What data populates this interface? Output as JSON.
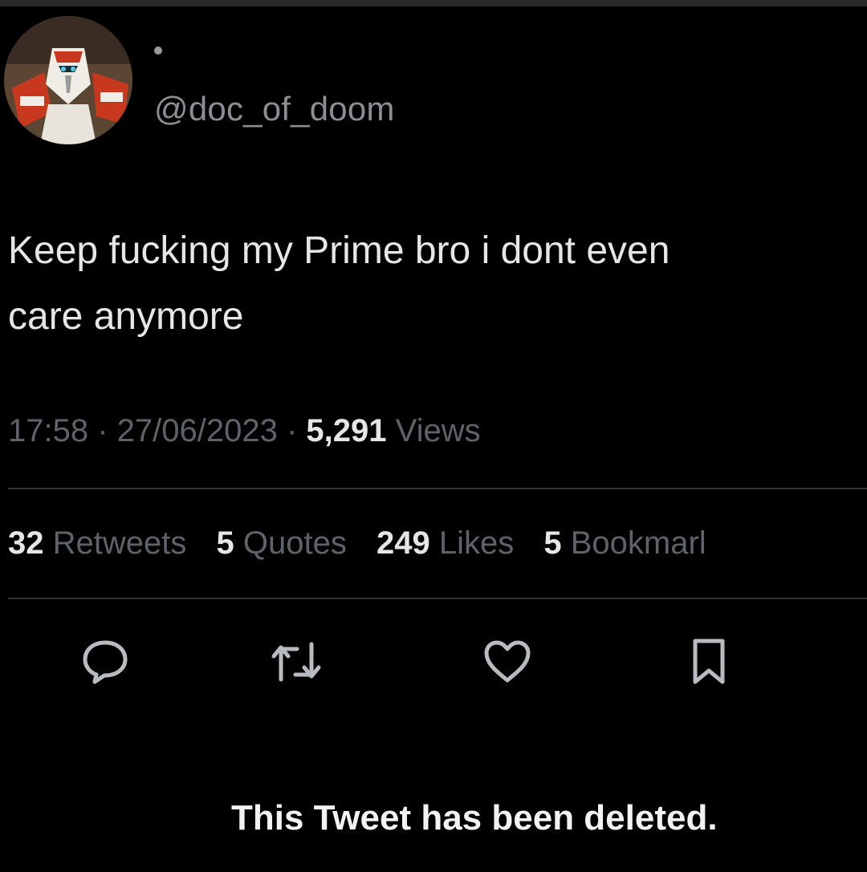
{
  "tweet": {
    "handle": "@doc_of_doom",
    "text_line1": "Keep fucking my Prime bro i dont even",
    "text_line2": "care anymore",
    "time": "17:58",
    "date": "27/06/2023",
    "views_count": "5,291",
    "views_label": "Views"
  },
  "stats": [
    {
      "count": "32",
      "label": "Retweets"
    },
    {
      "count": "5",
      "label": "Quotes"
    },
    {
      "count": "249",
      "label": "Likes"
    },
    {
      "count": "5",
      "label": "Bookmarl"
    }
  ],
  "actions": [
    "reply-icon",
    "retweet-icon",
    "like-icon",
    "bookmark-icon"
  ],
  "notice": "This Tweet has been deleted.",
  "colors": {
    "background": "#000000",
    "text": "#e6e6e6",
    "muted": "#5e6369",
    "divider": "#2f3336"
  }
}
